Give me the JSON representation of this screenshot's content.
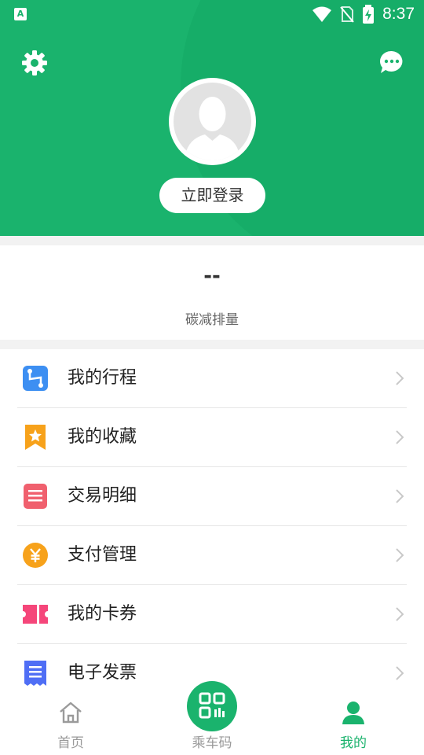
{
  "status_bar": {
    "time": "8:37",
    "app_badge": "A"
  },
  "header": {
    "settings_icon": "gear-icon",
    "message_icon": "chat-bubble-icon",
    "login_label": "立即登录"
  },
  "carbon": {
    "value": "--",
    "label": "碳减排量"
  },
  "menu": {
    "items": [
      {
        "label": "我的行程",
        "icon": "route-icon",
        "color": "#3d8ff2"
      },
      {
        "label": "我的收藏",
        "icon": "bookmark-star-icon",
        "color": "#f7a21b"
      },
      {
        "label": "交易明细",
        "icon": "list-doc-icon",
        "color": "#f0606e"
      },
      {
        "label": "支付管理",
        "icon": "yuan-coin-icon",
        "color": "#f7a21b"
      },
      {
        "label": "我的卡券",
        "icon": "ticket-icon",
        "color": "#f5467a"
      },
      {
        "label": "电子发票",
        "icon": "invoice-icon",
        "color": "#4f6ef5"
      }
    ]
  },
  "tabbar": {
    "tabs": [
      {
        "label": "首页",
        "icon": "home-icon"
      },
      {
        "label": "乘车码",
        "icon": "qr-code-icon"
      },
      {
        "label": "我的",
        "icon": "person-icon",
        "active": true
      }
    ]
  },
  "colors": {
    "brand": "#1ab36d"
  }
}
